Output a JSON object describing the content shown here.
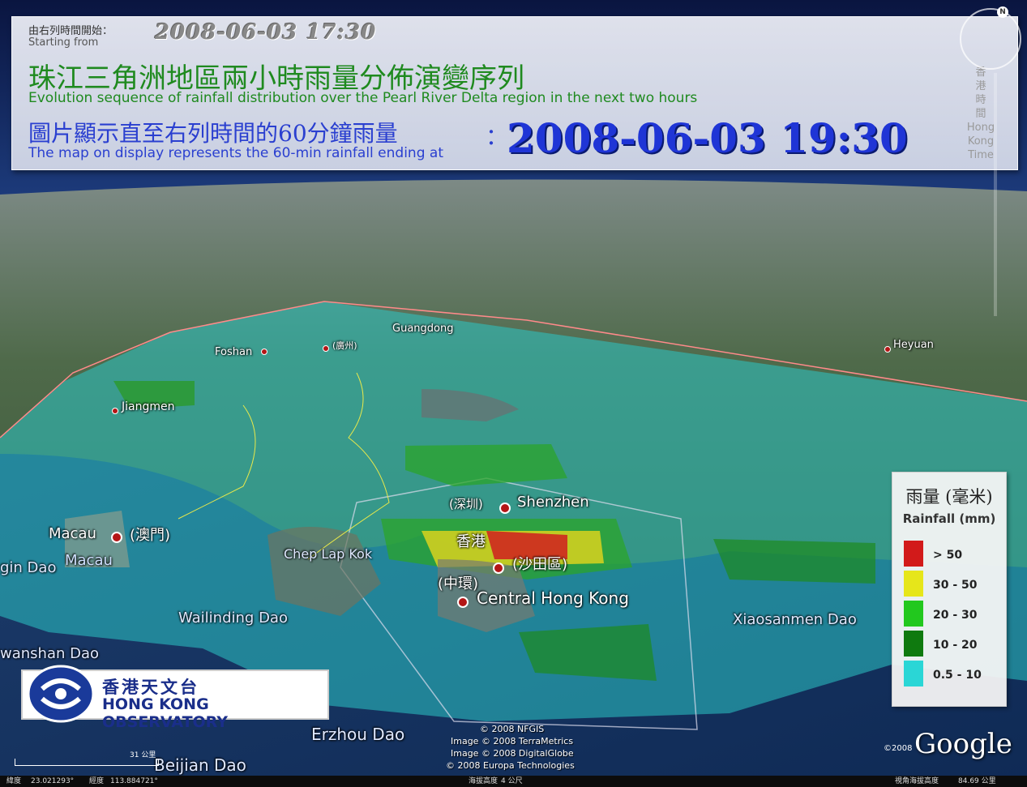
{
  "header": {
    "start_label_zh": "由右列時間開始：",
    "start_label_en": "Starting from",
    "start_time": "2008-06-03 17:30",
    "title_zh": "珠江三角洲地區兩小時雨量分佈演變序列",
    "title_en": "Evolution sequence of rainfall distribution over the Pearl River Delta region in the next two hours",
    "map_label_zh": "圖片顯示直至右列時間的60分鐘雨量",
    "map_label_en": "The map on display represents the 60-min rainfall ending at",
    "separator": "：",
    "end_time": "2008-06-03 19:30",
    "time_zone_zh": [
      "香",
      "港",
      "時",
      "間"
    ],
    "time_zone_en": [
      "Hong",
      "Kong",
      "Time"
    ]
  },
  "compass": {
    "north": "N"
  },
  "map_labels": {
    "guangdong": "Guangdong",
    "foshan": "Foshan",
    "guangzhou_zh": "(廣州)",
    "heyuan": "Heyuan",
    "jiangmen": "Jiangmen",
    "shenzhen_zh": "(深圳)",
    "shenzhen": "Shenzhen",
    "hongkong_zh": "香港",
    "shatin_zh": "(沙田區)",
    "central_zh": "(中環)",
    "central_hk": "Central Hong Kong",
    "macau": "Macau",
    "macau_zh": "(澳門)",
    "macau2": "Macau",
    "gin_dao": "gin Dao",
    "chep_lap_kok": "Chep Lap Kok",
    "wailinding": "Wailinding Dao",
    "wanshan": "wanshan Dao",
    "xiaosanmen": "Xiaosanmen Dao",
    "erzhou": "Erzhou Dao",
    "beijian": "Beijian Dao"
  },
  "legend": {
    "title_zh": "雨量 (毫米)",
    "title_en": "Rainfall (mm)",
    "items": [
      {
        "label": "> 50",
        "color": "#d21a1a"
      },
      {
        "label": "30 - 50",
        "color": "#e6e61a"
      },
      {
        "label": "20 - 30",
        "color": "#22c81e"
      },
      {
        "label": "10 - 20",
        "color": "#0f7a0f"
      },
      {
        "label": "0.5 - 10",
        "color": "#2ad6d6"
      }
    ]
  },
  "logo": {
    "zh": "香港天文台",
    "en": "HONG KONG OBSERVATORY"
  },
  "credits": [
    "© 2008 NFGIS",
    "Image © 2008 TerraMetrics",
    "Image © 2008 DigitalGlobe",
    "© 2008 Europa Technologies"
  ],
  "google": {
    "year": "©2008",
    "brand": "Google"
  },
  "scale": "31 公里",
  "status": {
    "lat_label": "緯度",
    "lat": "23.021293°",
    "lon_label": "經度",
    "lon": "113.884721°",
    "elev_label": "海拔高度",
    "elev": "4 公尺",
    "eye_label": "視角海拔高度",
    "eye": "84.69 公里"
  }
}
